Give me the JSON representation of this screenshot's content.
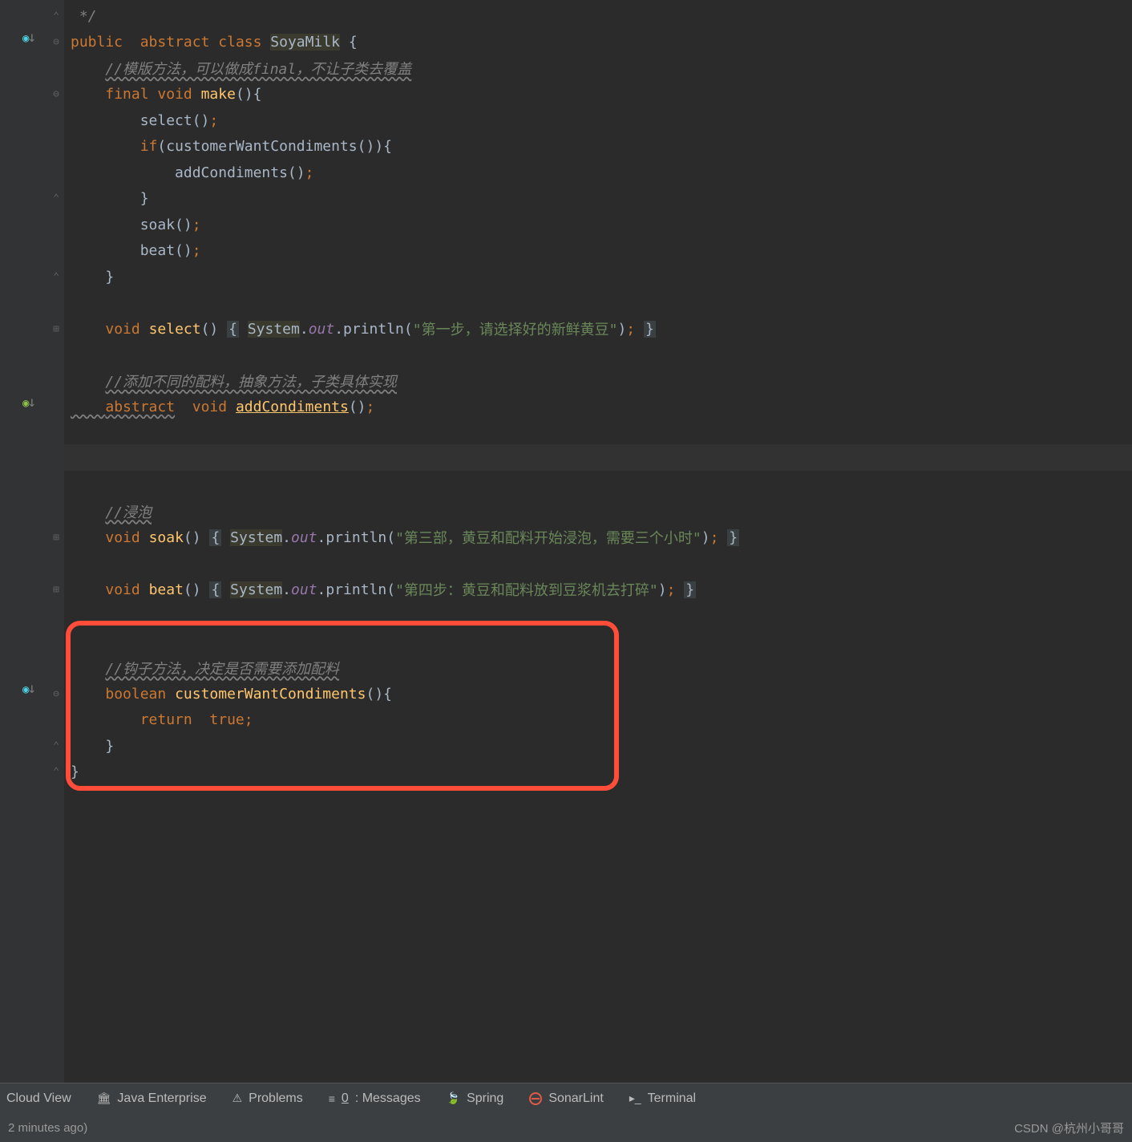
{
  "code": {
    "comment_end": " */",
    "class_decl": {
      "public": "public",
      "abstract": "abstract",
      "class": "class",
      "name": "SoyaMilk",
      "brace": " {"
    },
    "comment1": "//模版方法，可以做成final，不让子类去覆盖",
    "make": {
      "final": "final",
      "void": "void",
      "name": "make",
      "rest": "(){",
      "close": "}"
    },
    "select_call": "select();",
    "if_line": {
      "if": "if",
      "cond": "(customerWantCondiments()){"
    },
    "addCond_call": "addCondiments();",
    "brace_close": "}",
    "soak_call": "soak();",
    "beat_call": "beat();",
    "select_def": {
      "void": "void",
      "name": "select",
      "paren": "()",
      "sys": "System",
      "dot": ".",
      "out": "out",
      "println": ".println(",
      "str": "\"第一步，请选择好的新鲜黄豆\"",
      "end": ");"
    },
    "comment2": "//添加不同的配料，抽象方法，子类具体实现",
    "addCond_def": {
      "abstract": "abstract",
      "void": "void",
      "name": "addCondiments",
      "rest": "();"
    },
    "comment3": "//浸泡",
    "soak_def": {
      "void": "void",
      "name": "soak",
      "paren": "()",
      "sys": "System",
      "out": "out",
      "str": "\"第三部，黄豆和配料开始浸泡，需要三个小时\"",
      "end": ");"
    },
    "beat_def": {
      "void": "void",
      "name": "beat",
      "paren": "()",
      "sys": "System",
      "out": "out",
      "str": "\"第四步：黄豆和配料放到豆浆机去打碎\"",
      "end": ");"
    },
    "comment4": "//钩子方法，决定是否需要添加配料",
    "hook": {
      "boolean": "boolean",
      "name": "customerWantCondiments",
      "rest": "(){",
      "return": "return",
      "true": "true",
      "semi": ";"
    }
  },
  "bottom": {
    "cloud": "Cloud View",
    "java_ee": "Java Enterprise",
    "problems": "Problems",
    "messages_num": "0",
    "messages": ": Messages",
    "spring": "Spring",
    "sonar": "SonarLint",
    "terminal": "Terminal"
  },
  "status": {
    "left": "2 minutes ago)",
    "right": "CSDN @杭州小哥哥"
  }
}
